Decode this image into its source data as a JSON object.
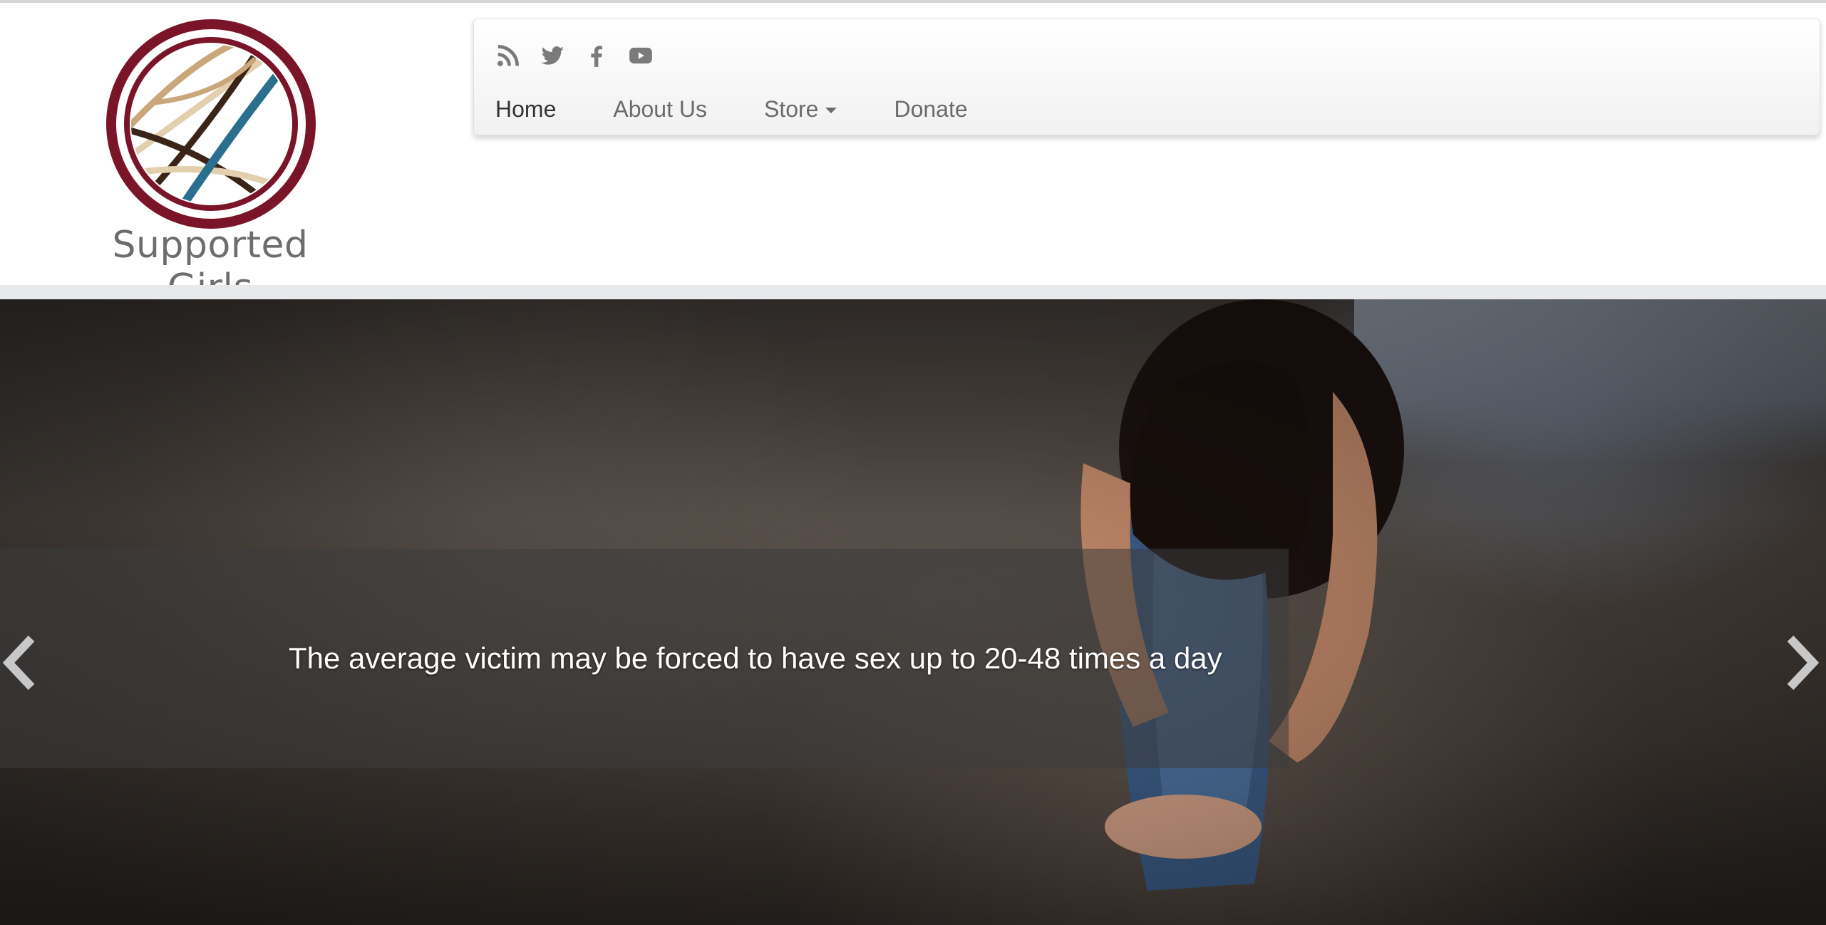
{
  "brand": {
    "name": "Supported Girls",
    "logo_icon": "ribbon-circle-logo-icon",
    "colors": {
      "ring": "#7a1428",
      "tan": "#c9a77a",
      "brown": "#3a2418",
      "teal": "#2a6f8e"
    }
  },
  "social_links": [
    {
      "icon": "rss-icon"
    },
    {
      "icon": "twitter-icon"
    },
    {
      "icon": "facebook-icon"
    },
    {
      "icon": "youtube-icon"
    }
  ],
  "nav": {
    "items": [
      {
        "label": "Home",
        "active": true
      },
      {
        "label": "About Us"
      },
      {
        "label": "Store",
        "has_dropdown": true
      },
      {
        "label": "Donate"
      }
    ]
  },
  "carousel": {
    "caption": "The average victim may be forced to have sex up to 20-48 times a day",
    "prev_icon": "chevron-left-icon",
    "next_icon": "chevron-right-icon"
  }
}
